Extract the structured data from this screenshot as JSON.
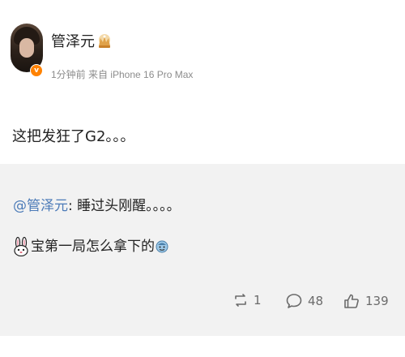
{
  "post": {
    "username": "管泽元",
    "meta": "1分钟前 来自 iPhone 16 Pro Max",
    "text": "这把发狂了G2。。。",
    "verified_badge": "v"
  },
  "repost": {
    "mention": "@管泽元",
    "mention_suffix": ": 睡过头刚醒。。。。",
    "comment": "宝第一局怎么拿下的"
  },
  "actions": {
    "repost_count": "1",
    "comment_count": "48",
    "like_count": "139"
  },
  "colors": {
    "mention": "#4c7bb8",
    "verified": "#ff8200",
    "background": "#f2f2f2"
  },
  "icons": [
    "crown-icon",
    "bunny-icon",
    "face-emoji-icon",
    "repost-icon",
    "comment-icon",
    "like-icon"
  ]
}
